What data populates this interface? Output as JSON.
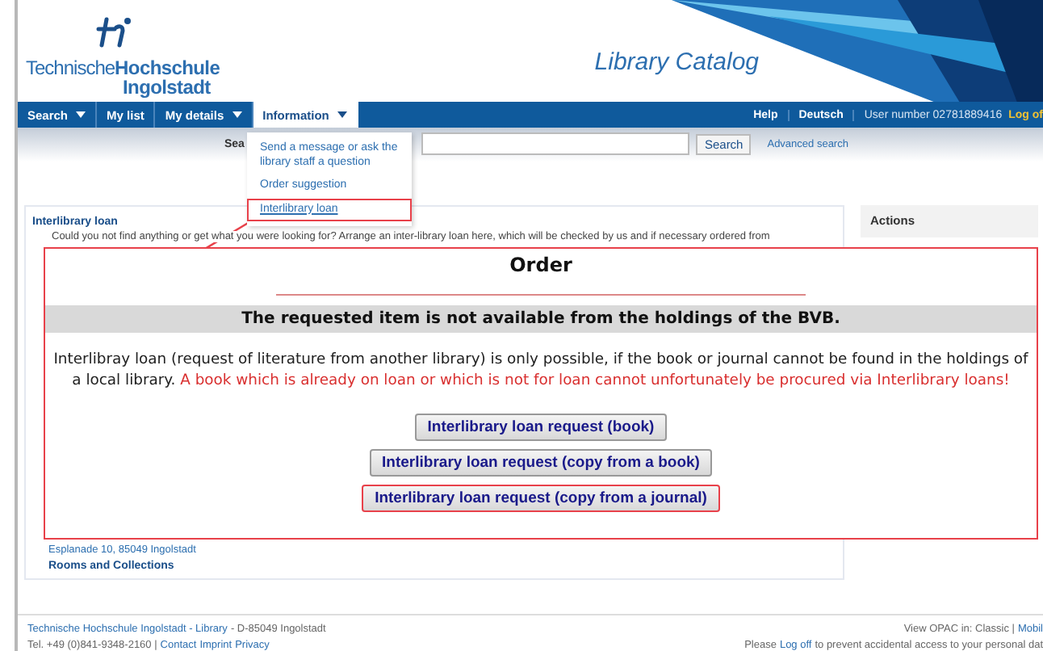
{
  "header": {
    "logo_line1": "Technische",
    "logo_line2": "Hochschule",
    "logo_line3": "Ingolstadt",
    "title": "Library Catalog"
  },
  "nav": {
    "left": [
      {
        "label": "Search",
        "has_menu": true,
        "selected": false
      },
      {
        "label": "My list",
        "has_menu": false,
        "selected": false
      },
      {
        "label": "My details",
        "has_menu": true,
        "selected": false
      },
      {
        "label": "Information",
        "has_menu": true,
        "selected": true
      }
    ],
    "right": [
      "Help",
      "Deutsch"
    ],
    "user": "User number 02781889416",
    "logout": "Log of"
  },
  "search_bar": {
    "label": "Sea",
    "button": "Search",
    "advanced": "Advanced search"
  },
  "dropdown": {
    "items": [
      {
        "label": "Send a message or ask the library staff a question",
        "highlighted": false
      },
      {
        "label": "Order suggestion",
        "highlighted": false
      },
      {
        "label": "Interlibrary loan",
        "highlighted": true
      }
    ]
  },
  "content": {
    "link": "Interlibrary loan",
    "description": "Could you not find anything or get what you were looking for? Arrange an inter-library loan here, which will be checked by us and if necessary ordered from",
    "address": "Esplanade 10, 85049 Ingolstadt",
    "rooms": "Rooms and Collections"
  },
  "actions": {
    "title": "Actions"
  },
  "order_dialog": {
    "title": "Order",
    "notice": "The requested item is not available from the holdings of the BVB.",
    "body": "Interlibray loan (request of literature from another library) is only possible, if the book or journal cannot be found in the holdings of a local library.",
    "warning": "A book which is already on loan or which is not for loan cannot unfortunately be procured via Interlibrary loans!",
    "buttons": [
      {
        "label": "Interlibrary loan request (book)",
        "highlighted": false
      },
      {
        "label": "Interlibrary loan request (copy from a book)",
        "highlighted": false
      },
      {
        "label": "Interlibrary loan request (copy from a journal)",
        "highlighted": true
      }
    ]
  },
  "footer": {
    "org_link": "Technische Hochschule Ingolstadt - Library",
    "org_rest": "- D-85049 Ingolstadt",
    "phone": "Tel. +49 (0)841-9348-2160 |",
    "links": [
      "Contact",
      "Imprint",
      "Privacy"
    ],
    "view_label": "View OPAC in: Classic |",
    "view_link": "Mobil",
    "notice_start": "Please",
    "notice_link": "Log off",
    "notice_end": "to prevent accidental access to your personal dat"
  }
}
